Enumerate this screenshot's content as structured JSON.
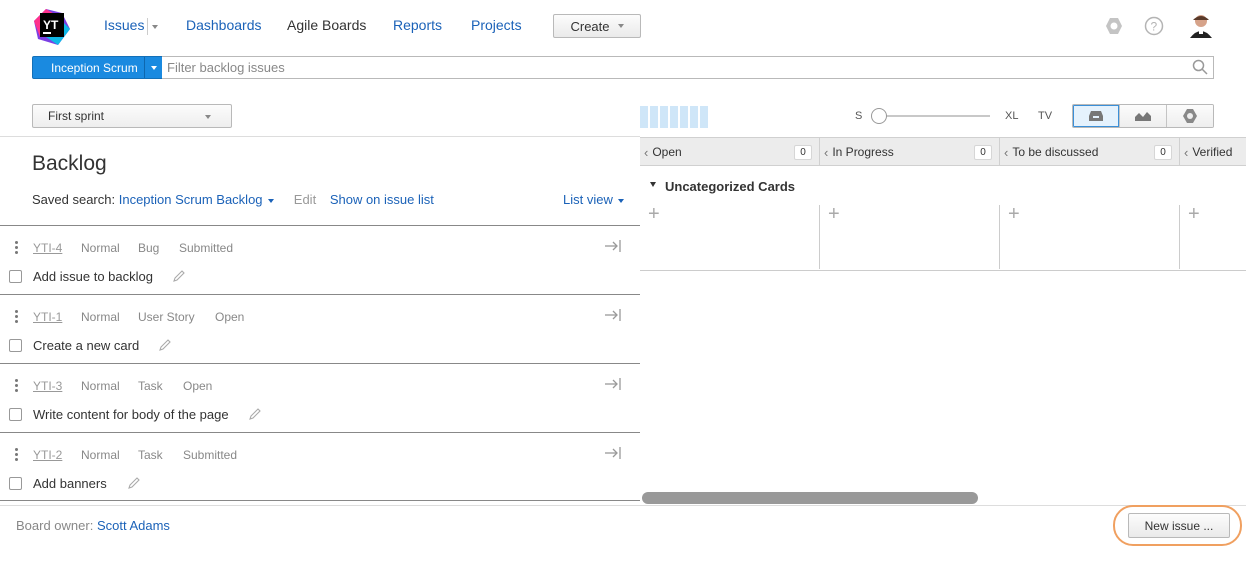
{
  "header": {
    "logo_text": "YT",
    "nav": [
      {
        "label": "Issues"
      },
      {
        "label": "Dashboards"
      },
      {
        "label": "Agile Boards"
      },
      {
        "label": "Reports"
      },
      {
        "label": "Projects"
      }
    ],
    "create_label": "Create",
    "icons": [
      "settings-icon",
      "help-icon",
      "user-avatar"
    ]
  },
  "toolbar": {
    "board_name": "Inception Scrum",
    "search_placeholder": "Filter backlog issues",
    "sprint": "First sprint",
    "size_labels": {
      "s": "S",
      "xl": "XL",
      "tv": "TV"
    },
    "view_buttons": [
      "board-view-icon",
      "chart-view-icon",
      "settings-icon"
    ]
  },
  "backlog": {
    "title": "Backlog",
    "saved_search_label": "Saved search:",
    "saved_search_name": "Inception Scrum Backlog",
    "edit_label": "Edit",
    "show_on_list_label": "Show on issue list",
    "list_view_label": "List view",
    "issues": [
      {
        "id": "YTI-4",
        "priority": "Normal",
        "type": "Bug",
        "state": "Submitted",
        "summary": "Add issue to backlog"
      },
      {
        "id": "YTI-1",
        "priority": "Normal",
        "type": "User Story",
        "state": "Open",
        "summary": "Create a new card"
      },
      {
        "id": "YTI-3",
        "priority": "Normal",
        "type": "Task",
        "state": "Open",
        "summary": "Write content for body of the page"
      },
      {
        "id": "YTI-2",
        "priority": "Normal",
        "type": "Task",
        "state": "Submitted",
        "summary": "Add banners"
      }
    ]
  },
  "board": {
    "columns": [
      {
        "name": "Open",
        "count": "0"
      },
      {
        "name": "In Progress",
        "count": "0"
      },
      {
        "name": "To be discussed",
        "count": "0"
      },
      {
        "name": "Verified",
        "count": ""
      }
    ],
    "swimlane": "Uncategorized Cards"
  },
  "footer": {
    "owner_label": "Board owner:",
    "owner_name": "Scott Adams",
    "new_issue_label": "New issue ..."
  },
  "colors": {
    "accent": "#1a8ae0",
    "link": "#1b62b8",
    "highlight_ring": "#f0a060"
  }
}
